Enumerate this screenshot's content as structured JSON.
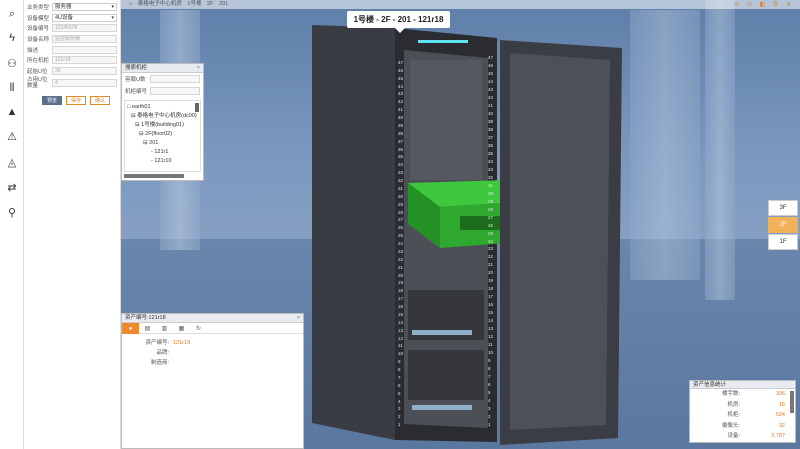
{
  "app": {
    "icon_rail": [
      "search-icon",
      "fire-icon",
      "network-icon",
      "plug-icon",
      "warning-icon",
      "alert-icon",
      "report-icon",
      "swap-icon",
      "walk-icon"
    ]
  },
  "breadcrumb": [
    "⌂",
    "泰格电子中心机房",
    "1号楼",
    "2F",
    "201"
  ],
  "device_form": {
    "fields": [
      {
        "label": "业务类型",
        "value": "服务器",
        "kind": "select"
      },
      {
        "label": "设备模型",
        "value": "4U设备",
        "kind": "select"
      },
      {
        "label": "设备编号",
        "value": "12345678",
        "kind": "text"
      },
      {
        "label": "设备名称",
        "value": "监控服务器",
        "kind": "text"
      },
      {
        "label": "描述",
        "value": "",
        "kind": "text"
      },
      {
        "label": "所在机柜",
        "value": "121r18",
        "kind": "text"
      },
      {
        "label": "起始U位",
        "value": "30",
        "kind": "text"
      },
      {
        "label": "占用U位数量",
        "value": "4",
        "kind": "text"
      }
    ],
    "buttons": {
      "preview": "预览",
      "save": "保存",
      "confirm": "确认"
    }
  },
  "rack_search": {
    "title": "搜索机柜",
    "rack_u_label": "容载U数",
    "rack_no_label": "机柜编号",
    "tree": [
      "earth01",
      "泰格电子中心机房(dc00)",
      "1号楼(building01)",
      "2F(floor02)",
      "201",
      "121r1",
      "121r10"
    ]
  },
  "rack_title": "1号楼 - 2F - 201 - 121r18",
  "asset_panel": {
    "title": "资产编号:121r18",
    "tabs": [
      "info-icon",
      "list-icon",
      "chart-icon",
      "doc-icon",
      "refresh-icon"
    ],
    "rows": [
      {
        "k": "资产编号:",
        "v": "121r18"
      },
      {
        "k": "品牌:",
        "v": ""
      },
      {
        "k": "制造商:",
        "v": ""
      }
    ]
  },
  "floors": [
    "3F",
    "2F",
    "1F"
  ],
  "active_floor": "2F",
  "stats": {
    "title": "资产信息统计",
    "rows": [
      {
        "k": "楼宇数:",
        "v": "306"
      },
      {
        "k": "机房:",
        "v": "15"
      },
      {
        "k": "机柜:",
        "v": "524"
      },
      {
        "k": "摄像头:",
        "v": "32"
      },
      {
        "k": "设备:",
        "v": "2,787"
      }
    ]
  },
  "colors": {
    "accent": "#ee8a2e",
    "rack_body": "#3b3d44",
    "server_green": "#2ea82e"
  },
  "rack_u_numbers": [
    "47",
    "46",
    "45",
    "44",
    "43",
    "42",
    "41",
    "40",
    "39",
    "38",
    "37",
    "36",
    "35",
    "34",
    "33",
    "32",
    "31",
    "30",
    "29",
    "28",
    "27",
    "26",
    "25",
    "24",
    "23",
    "22",
    "21",
    "20",
    "19",
    "18",
    "17",
    "16",
    "15",
    "14",
    "13",
    "12",
    "11",
    "10",
    "9",
    "8",
    "7",
    "6",
    "5",
    "4",
    "3",
    "2",
    "1"
  ]
}
